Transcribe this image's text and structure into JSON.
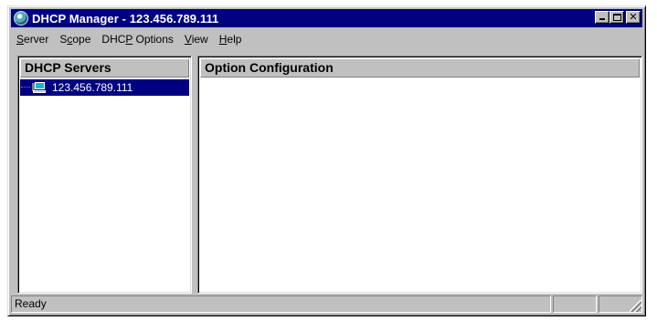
{
  "window": {
    "title": "DHCP Manager - 123.456.789.111"
  },
  "title_buttons": {
    "minimize": "_",
    "maximize": "□",
    "close": "✕"
  },
  "menu": [
    {
      "before": "",
      "accel": "S",
      "after": "erver"
    },
    {
      "before": "S",
      "accel": "c",
      "after": "ope"
    },
    {
      "before": "DHC",
      "accel": "P",
      "after": " Options"
    },
    {
      "before": "",
      "accel": "V",
      "after": "iew"
    },
    {
      "before": "",
      "accel": "H",
      "after": "elp"
    }
  ],
  "left_pane": {
    "header": "DHCP Servers",
    "items": [
      {
        "label": "123.456.789.111",
        "selected": true,
        "icon": "server-computer-icon"
      }
    ]
  },
  "right_pane": {
    "header": "Option Configuration"
  },
  "status": {
    "text": "Ready"
  },
  "colors": {
    "titlebar": "#000080",
    "face": "#c0c0c0",
    "selection": "#000080"
  }
}
